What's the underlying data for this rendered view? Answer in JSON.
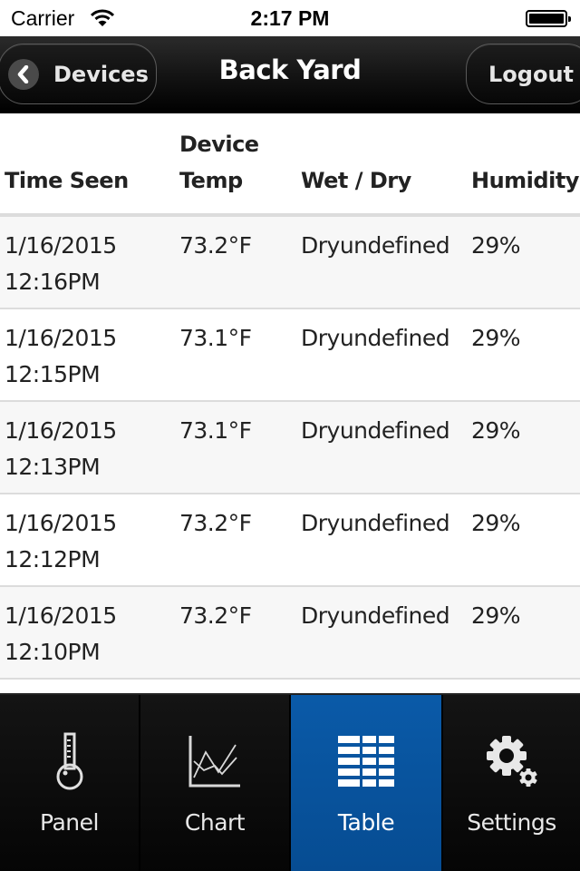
{
  "status_bar": {
    "carrier": "Carrier",
    "time": "2:17 PM",
    "wifi_icon": "wifi-icon",
    "battery_icon": "battery-full-icon"
  },
  "nav_bar": {
    "title": "Back Yard",
    "back_button": {
      "label": "Devices",
      "icon": "chevron-left-icon"
    },
    "logout_button": {
      "label": "Logout"
    }
  },
  "table": {
    "headers": {
      "time_seen": "Time Seen",
      "device_temp_line1": "Device",
      "device_temp_line2": "Temp",
      "wet_dry": "Wet / Dry",
      "humidity": "Humidity"
    },
    "rows": [
      {
        "date": "1/16/2015",
        "time": "12:16PM",
        "temp": "73.2°F",
        "wet_dry": "Dryundefined",
        "humidity": "29%"
      },
      {
        "date": "1/16/2015",
        "time": "12:15PM",
        "temp": "73.1°F",
        "wet_dry": "Dryundefined",
        "humidity": "29%"
      },
      {
        "date": "1/16/2015",
        "time": "12:13PM",
        "temp": "73.1°F",
        "wet_dry": "Dryundefined",
        "humidity": "29%"
      },
      {
        "date": "1/16/2015",
        "time": "12:12PM",
        "temp": "73.2°F",
        "wet_dry": "Dryundefined",
        "humidity": "29%"
      },
      {
        "date": "1/16/2015",
        "time": "12:10PM",
        "temp": "73.2°F",
        "wet_dry": "Dryundefined",
        "humidity": "29%"
      }
    ]
  },
  "tab_bar": {
    "active_color": "#0a5aa8",
    "tabs": [
      {
        "label": "Panel",
        "icon": "thermometer-icon",
        "active": false
      },
      {
        "label": "Chart",
        "icon": "line-chart-icon",
        "active": false
      },
      {
        "label": "Table",
        "icon": "table-grid-icon",
        "active": true
      },
      {
        "label": "Settings",
        "icon": "gears-icon",
        "active": false
      }
    ]
  }
}
